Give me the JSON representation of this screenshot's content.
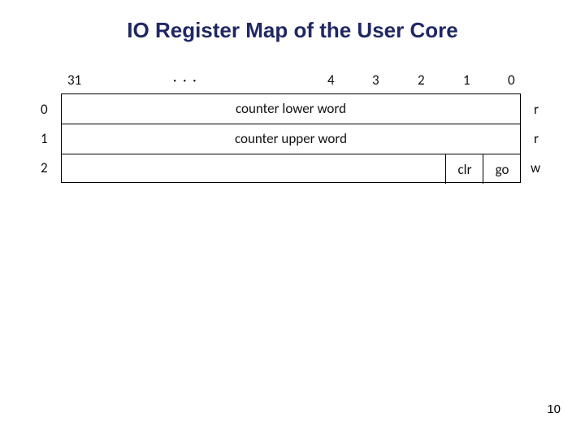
{
  "title": "IO Register Map of the User Core",
  "bitLabels": {
    "b31": "31",
    "ellipsis": "· · ·",
    "b4": "4",
    "b3": "3",
    "b2": "2",
    "b1": "1",
    "b0": "0"
  },
  "rowLabels": {
    "r0": "0",
    "r1": "1",
    "r2": "2"
  },
  "rows": {
    "row0": "counter lower word",
    "row1": "counter upper word",
    "row2_clr": "clr",
    "row2_go": "go"
  },
  "access": {
    "a0": "r",
    "a1": "r",
    "a2": "w"
  },
  "pageNumber": "10"
}
